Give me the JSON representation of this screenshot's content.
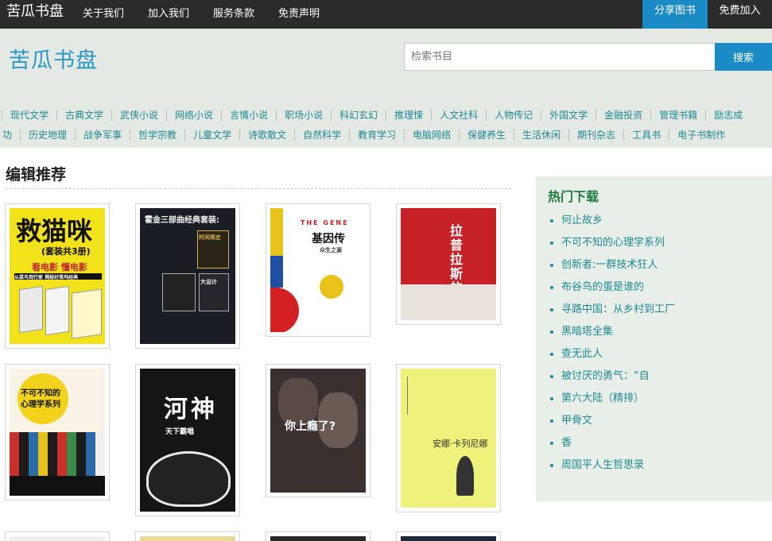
{
  "topbar": {
    "brand": "苦瓜书盘",
    "nav": [
      "关于我们",
      "加入我们",
      "服务条款",
      "免责声明"
    ],
    "share_label": "分享图书",
    "join_label": "免费加入"
  },
  "header": {
    "logo": "苦瓜书盘",
    "search_placeholder": "检索书目",
    "search_button": "搜索"
  },
  "categories_row1": [
    "现代文学",
    "古典文学",
    "武侠小说",
    "网络小说",
    "言情小说",
    "职场小说",
    "科幻玄幻",
    "推理悚",
    "人文社科",
    "人物传记",
    "外国文学",
    "金融投资",
    "管理书籍",
    "励志成"
  ],
  "categories_row2": [
    "功",
    "历史地理",
    "战争军事",
    "哲学宗教",
    "儿童文学",
    "诗歌散文",
    "自然科学",
    "教育学习",
    "电脑网络",
    "保健养生",
    "生活休闲",
    "期刊杂志",
    "工具书",
    "电子书制作"
  ],
  "main": {
    "section_title": "编辑推荐"
  },
  "books": [
    {
      "cover_text": [
        "救猫咪",
        "(套装共3册)",
        "看电影 懂电影",
        "从菜鸟到行家 揭秘好莱坞经典"
      ],
      "cover_color": "#f2e21a"
    },
    {
      "cover_text": [
        "霍金三部曲经典套装:",
        "时间简史",
        "大设计"
      ],
      "cover_color": "#1a1d24"
    },
    {
      "cover_text": [
        "THE GENE",
        "基因传",
        "众生之源"
      ],
      "cover_color": "#ffffff"
    },
    {
      "cover_text": [
        "拉普拉斯的魔女"
      ],
      "cover_color": "#c52127"
    },
    {
      "cover_text": [
        "不可不知的",
        "心理学系列"
      ],
      "cover_color": "#f9f3e6"
    },
    {
      "cover_text": [
        "河神",
        "天下霸唱"
      ],
      "cover_color": "#151515"
    },
    {
      "cover_text": [
        "你上瘾了?"
      ],
      "cover_color": "#3a3030"
    },
    {
      "cover_text": [
        "安娜·卡列尼娜"
      ],
      "cover_color": "#eef27a"
    }
  ],
  "sidebar": {
    "title": "热门下载",
    "items": [
      "何止故乡",
      "不可不知的心理学系列",
      "创新者:一群技术狂人",
      "布谷鸟的蛋是谁的",
      "寻路中国：从乡村到工厂",
      "黑暗塔全集",
      "查无此人",
      "被讨厌的勇气：“自",
      "第六大陆（精排）",
      "甲骨文",
      "香",
      "周国平人生哲思录"
    ]
  },
  "colors": {
    "accent": "#1a8bc4",
    "topbar_bg": "#2b2b2b",
    "header_bg": "#e4e9e4",
    "link": "#1e8a94",
    "sidebar_title": "#1b7a3a"
  }
}
